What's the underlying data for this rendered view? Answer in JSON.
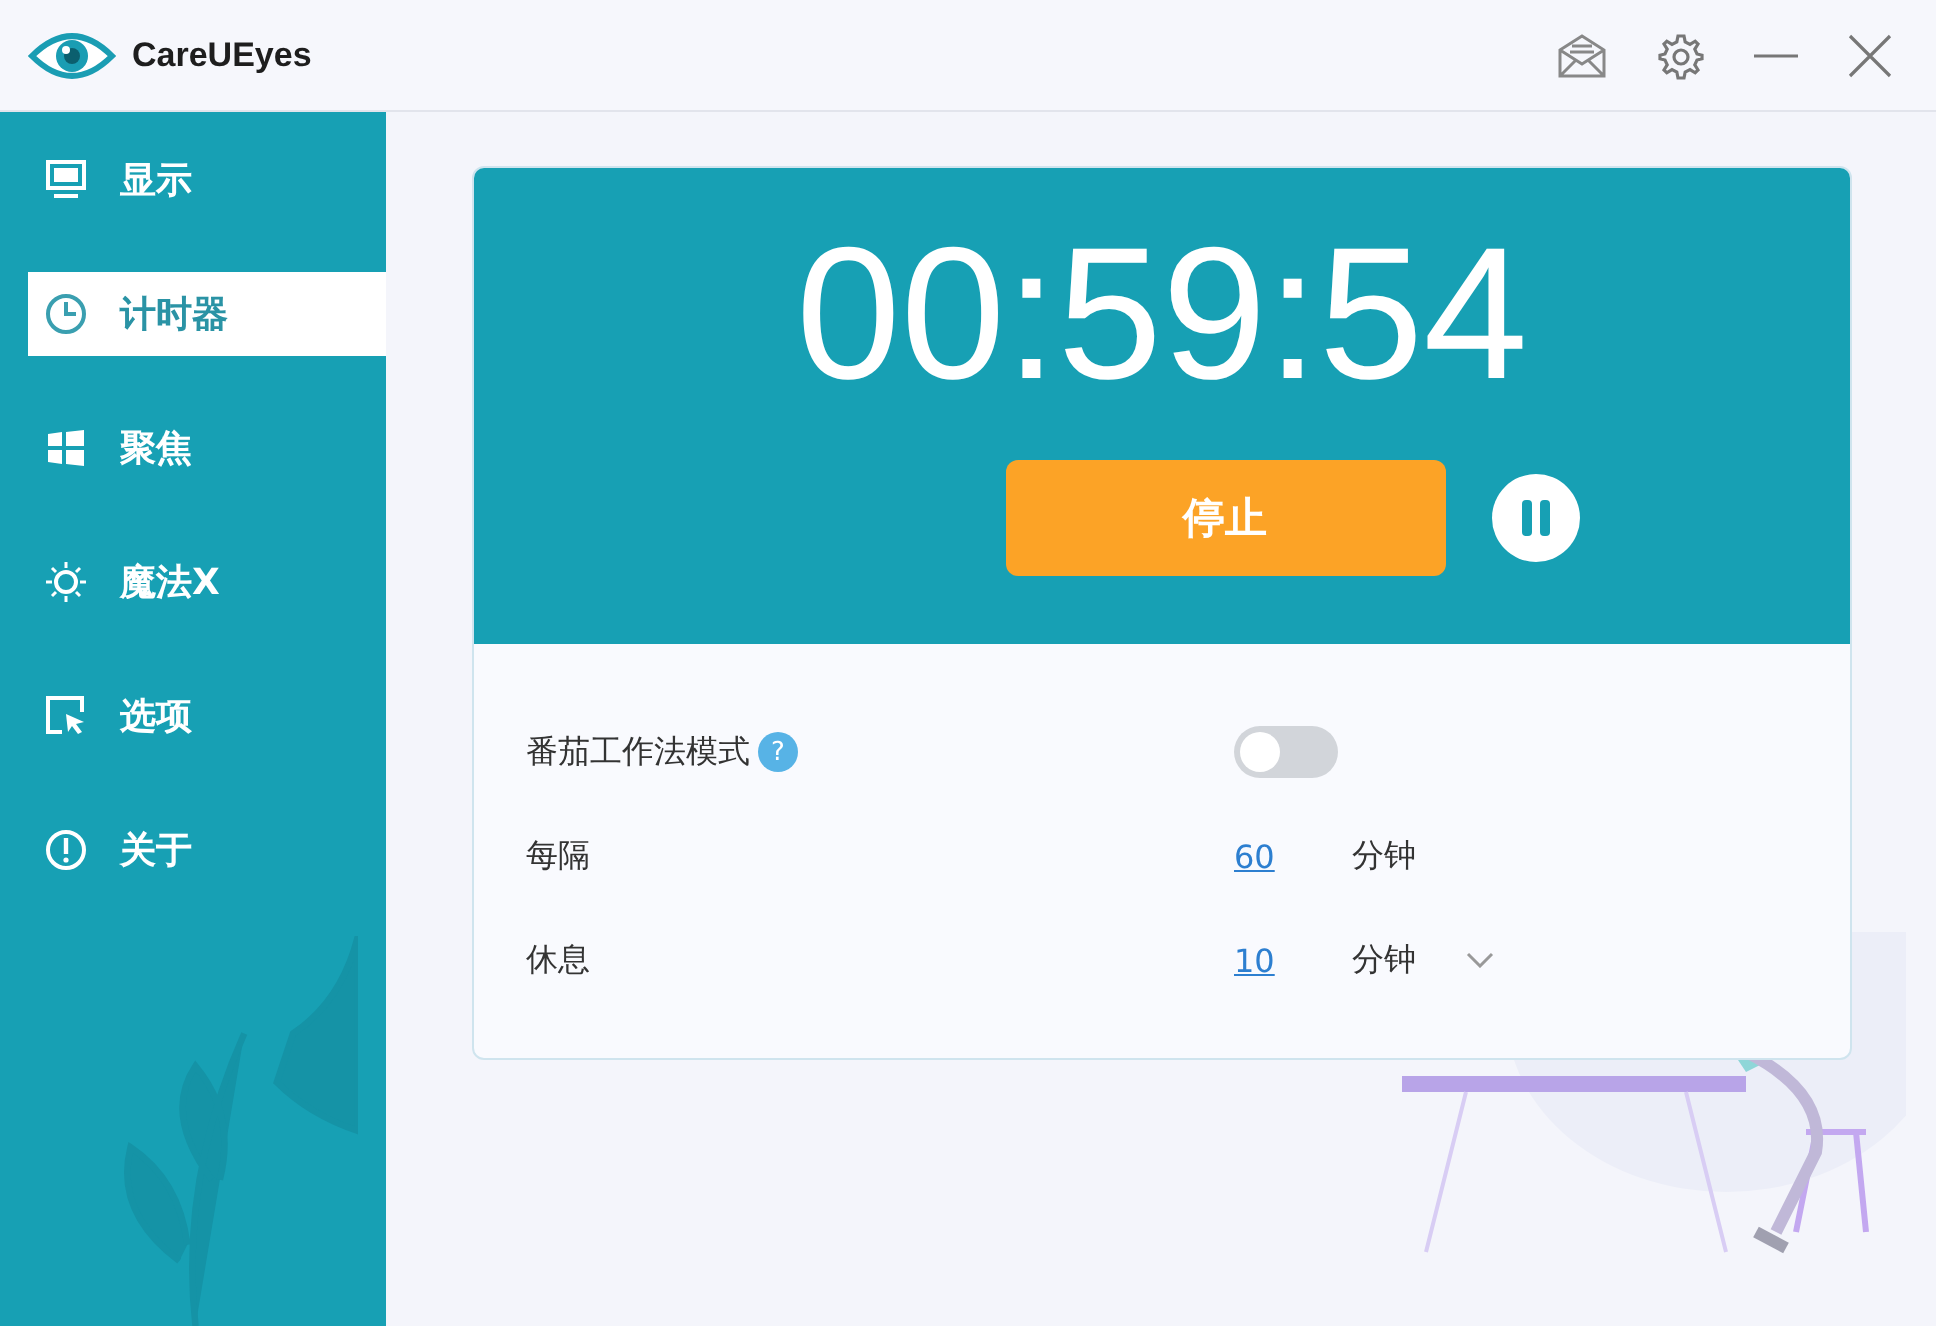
{
  "window": {
    "title": "CareUEyes"
  },
  "sidebar": {
    "items": [
      {
        "label": "显示",
        "selected": false
      },
      {
        "label": "计时器",
        "selected": true
      },
      {
        "label": "聚焦",
        "selected": false
      },
      {
        "label": "魔法X",
        "selected": false
      },
      {
        "label": "选项",
        "selected": false
      },
      {
        "label": "关于",
        "selected": false
      }
    ]
  },
  "timer": {
    "time": "00:59:54",
    "stop_button": "停止"
  },
  "settings": [
    {
      "kind": "toggle",
      "label": "番茄工作法模式",
      "help": "?",
      "on": false
    },
    {
      "kind": "number",
      "label": "每隔",
      "value": "60",
      "unit": "分钟"
    },
    {
      "kind": "number",
      "label": "休息",
      "value": "10",
      "unit": "分钟",
      "dropdown": true
    }
  ]
}
